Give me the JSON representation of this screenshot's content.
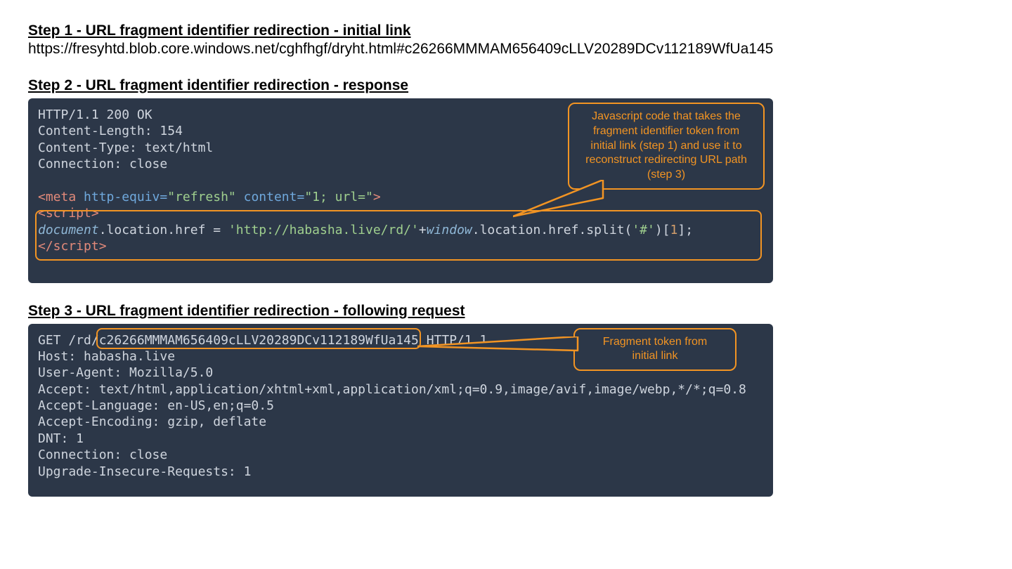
{
  "step1": {
    "title": "Step 1 - URL fragment identifier redirection - initial link",
    "url": "https://fresyhtd.blob.core.windows.net/cghfhgf/dryht.html#c26266MMMAM656409cLLV20289DCv112189WfUa145"
  },
  "step2": {
    "title": "Step 2 - URL fragment identifier redirection - response",
    "http_line": "HTTP/1.1 200 OK",
    "hdr_len": "Content-Length: 154",
    "hdr_ct": "Content-Type: text/html",
    "hdr_conn": "Connection: close",
    "meta_open": "<meta",
    "meta_attr1": " http-equiv=",
    "meta_val1": "\"refresh\"",
    "meta_attr2": " content=",
    "meta_val2": "\"1; url=\"",
    "meta_close": ">",
    "script_open": "<script>",
    "js_doc": "document",
    "js_dot1": ".location.href = ",
    "js_str1": "'http://habasha.live/rd/'",
    "js_plus": "+",
    "js_win": "window",
    "js_dot2": ".location.href.split(",
    "js_str2": "'#'",
    "js_brk": ")[",
    "js_num": "1",
    "js_end": "];",
    "script_close": "</script>",
    "callout_l1": "Javascript code that takes the",
    "callout_l2": "fragment identifier token from",
    "callout_l3": "initial link (step 1) and use it to",
    "callout_l4": "reconstruct redirecting URL path",
    "callout_l5": "(step 3)"
  },
  "step3": {
    "title": "Step 3 - URL fragment identifier redirection - following request",
    "req_pre": "GET /rd/",
    "req_token": "c26266MMMAM656409cLLV20289DCv112189WfUa145",
    "req_post": " HTTP/1.1",
    "host": "Host: habasha.live",
    "ua": "User-Agent: Mozilla/5.0",
    "accept": "Accept: text/html,application/xhtml+xml,application/xml;q=0.9,image/avif,image/webp,*/*;q=0.8",
    "lang": "Accept-Language: en-US,en;q=0.5",
    "enc": "Accept-Encoding: gzip, deflate",
    "dnt": "DNT: 1",
    "conn": "Connection: close",
    "upg": "Upgrade-Insecure-Requests: 1",
    "callout_l1": "Fragment token from",
    "callout_l2": "initial link"
  }
}
